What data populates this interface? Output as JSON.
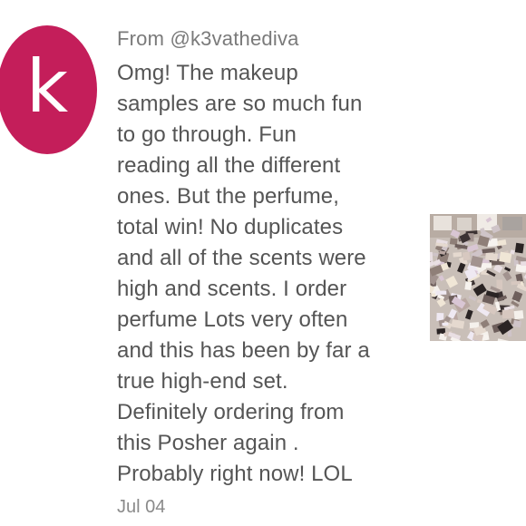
{
  "review": {
    "avatar": {
      "letter": "k",
      "color": "#c41e5a"
    },
    "from_label": "From @k3vathediva",
    "lines": [
      "Omg! The makeup",
      "samples are so much fun",
      "to go through. Fun",
      "reading all the different",
      "ones. But the perfume,",
      "total win! No duplicates",
      "and all of the scents were",
      "high and scents. I order",
      "perfume Lots very often",
      "and this has been by far a",
      "true high-end set.",
      "Definitely ordering from",
      "this Posher again .",
      "Probably right now! LOL"
    ],
    "date": "Jul 04",
    "photo": {
      "icon": "perfume-samples-photo"
    }
  }
}
